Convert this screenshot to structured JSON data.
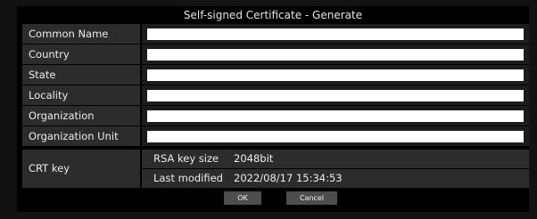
{
  "dialog": {
    "title": "Self-signed Certificate - Generate"
  },
  "fields": [
    {
      "label": "Common Name",
      "value": ""
    },
    {
      "label": "Country",
      "value": ""
    },
    {
      "label": "State",
      "value": ""
    },
    {
      "label": "Locality",
      "value": ""
    },
    {
      "label": "Organization",
      "value": ""
    },
    {
      "label": "Organization Unit",
      "value": ""
    }
  ],
  "crt_key": {
    "label": "CRT key",
    "rsa_key_size_label": "RSA key size",
    "rsa_key_size_value": "2048bit",
    "last_modified_label": "Last modified",
    "last_modified_value": "2022/08/17 15:34:53"
  },
  "buttons": {
    "ok_label": "OK",
    "cancel_label": "Cancel"
  }
}
